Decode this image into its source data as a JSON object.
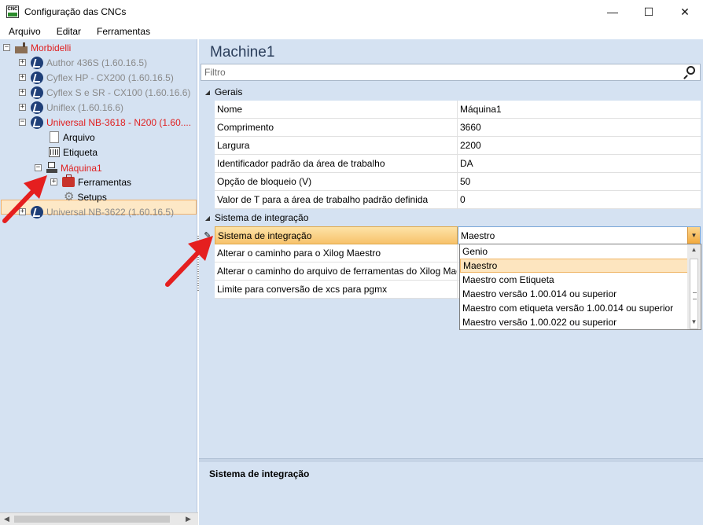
{
  "window": {
    "title": "Configuração das CNCs",
    "icon_text": "CNC",
    "controls": {
      "minimize": "—",
      "maximize": "☐",
      "close": "✕"
    }
  },
  "menu": [
    "Arquivo",
    "Editar",
    "Ferramentas"
  ],
  "tree": {
    "root": "Morbidelli",
    "machines": [
      "Author 436S (1.60.16.5)",
      "Cyflex HP - CX200 (1.60.16.5)",
      "Cyflex S e SR - CX100 (1.60.16.6)",
      "Uniflex (1.60.16.6)",
      "Universal NB-3618 - N200 (1.60...."
    ],
    "children": [
      "Arquivo",
      "Etiqueta",
      "Máquina1"
    ],
    "machine_children": [
      "Ferramentas",
      "Setups"
    ],
    "last_machine": "Universal NB-3622 (1.60.16.5)"
  },
  "main": {
    "title": "Machine1",
    "filter_placeholder": "Filtro",
    "categories": [
      {
        "label": "Gerais",
        "rows": [
          {
            "name": "Nome",
            "value": "Máquina1"
          },
          {
            "name": "Comprimento",
            "value": "3660"
          },
          {
            "name": "Largura",
            "value": "2200"
          },
          {
            "name": "Identificador padrão da área de trabalho",
            "value": "DA"
          },
          {
            "name": "Opção de bloqueio (V)",
            "value": "50"
          },
          {
            "name": "Valor de T para a área de trabalho padrão definida",
            "value": "0"
          }
        ]
      },
      {
        "label": "Sistema de integração",
        "rows": [
          {
            "name": "Sistema de integração",
            "value": "Maestro"
          },
          {
            "name": "Alterar o caminho para o Xilog Maestro",
            "value": ""
          },
          {
            "name": "Alterar o caminho do arquivo de ferramentas do Xilog Mae...",
            "value": ""
          },
          {
            "name": "Limite para conversão de xcs para pgmx",
            "value": ""
          }
        ]
      }
    ],
    "dropdown_options": [
      "Genio",
      "Maestro",
      "Maestro com Etiqueta",
      "Maestro versão 1.00.014 ou superior",
      "Maestro com etiqueta versão 1.00.014 ou superior",
      "Maestro versão 1.00.022 ou superior"
    ],
    "selected_option": "Maestro",
    "description_title": "Sistema de integração"
  },
  "colors": {
    "pane_bg": "#d5e2f2",
    "highlight_red": "#e02020",
    "selection_orange": "#f7c26b",
    "arrow_red": "#e51f1f"
  }
}
